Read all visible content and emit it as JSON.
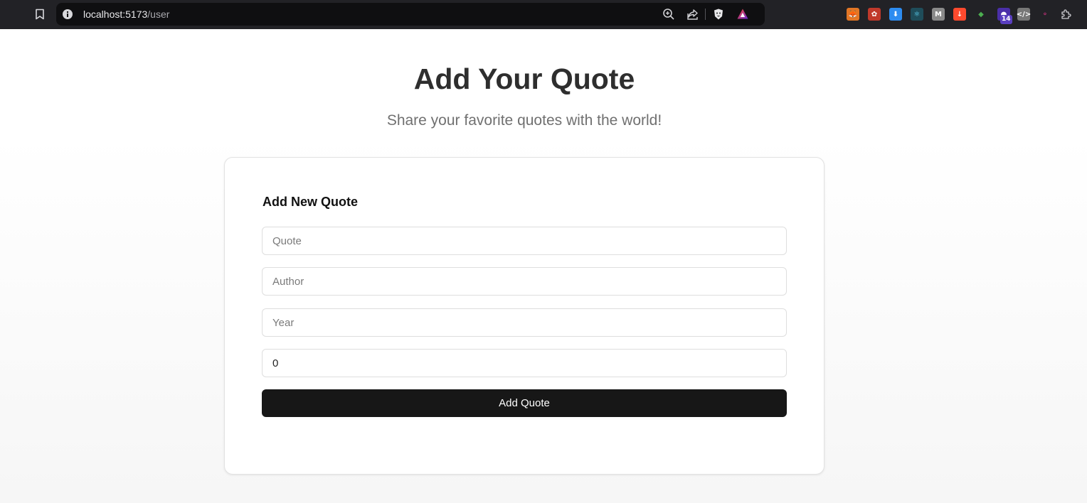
{
  "browser": {
    "url_host": "localhost:5173",
    "url_path": "/user",
    "extension_badge": "14",
    "colors": {
      "chrome_bg": "#222226",
      "omnibox_bg": "#0f0f11"
    },
    "icons": {
      "bookmark": "bookmark-icon",
      "site_info": "info-icon",
      "zoom": "zoom-in-icon",
      "share": "share-icon",
      "shield": "brave-shields-icon",
      "rewards": "brave-rewards-icon",
      "extensions": "puzzle-icon"
    }
  },
  "page": {
    "title": "Add Your Quote",
    "subtitle": "Share your favorite quotes with the world!"
  },
  "form": {
    "heading": "Add New Quote",
    "quote_placeholder": "Quote",
    "author_placeholder": "Author",
    "year_placeholder": "Year",
    "number_value": "0",
    "submit_label": "Add Quote",
    "colors": {
      "button_bg": "#171717",
      "button_text": "#ffffff"
    }
  }
}
